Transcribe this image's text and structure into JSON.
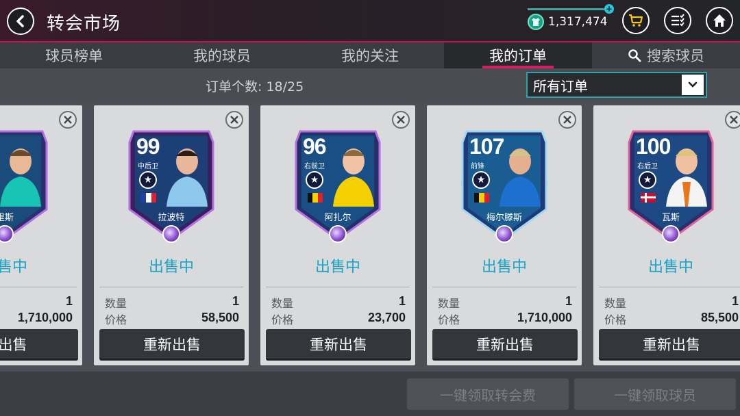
{
  "header": {
    "title": "转会市场",
    "coins": "1,317,474"
  },
  "tabs": [
    {
      "label": "球员榜单"
    },
    {
      "label": "我的球员"
    },
    {
      "label": "我的关注"
    },
    {
      "label": "我的订单",
      "active": true
    },
    {
      "label": "搜索球员",
      "icon": "search-icon"
    }
  ],
  "toolbar": {
    "order_count_label": "订单个数:",
    "order_count": "18/25",
    "filter_selected": "所有订单"
  },
  "cards": [
    {
      "rating": "",
      "position": "",
      "name": "里斯",
      "status": "出售中",
      "qty_label": "",
      "qty": "1",
      "price_label": "",
      "price": "1,710,000",
      "button": "新出售",
      "flag": "fr"
    },
    {
      "rating": "99",
      "position": "中后卫",
      "name": "拉波特",
      "status": "出售中",
      "qty_label": "数量",
      "qty": "1",
      "price_label": "价格",
      "price": "58,500",
      "button": "重新出售",
      "flag": "fr"
    },
    {
      "rating": "96",
      "position": "右前卫",
      "name": "阿扎尔",
      "status": "出售中",
      "qty_label": "数量",
      "qty": "1",
      "price_label": "价格",
      "price": "23,700",
      "button": "重新出售",
      "flag": "be"
    },
    {
      "rating": "107",
      "position": "前锋",
      "name": "梅尔滕斯",
      "status": "出售中",
      "qty_label": "数量",
      "qty": "1",
      "price_label": "价格",
      "price": "1,710,000",
      "button": "重新出售",
      "flag": "be"
    },
    {
      "rating": "100",
      "position": "右后卫",
      "name": "瓦斯",
      "status": "出售中",
      "qty_label": "数量",
      "qty": "1",
      "price_label": "价格",
      "price": "85,500",
      "button": "重新出售",
      "flag": "dk"
    }
  ],
  "bottom": {
    "collect_fee_label": "一键领取转会费",
    "collect_players_label": "一键领取球员"
  },
  "colors": {
    "accent_pink": "#d91c66",
    "accent_teal": "#2fa3a5",
    "status_blue": "#1aa3c4"
  }
}
